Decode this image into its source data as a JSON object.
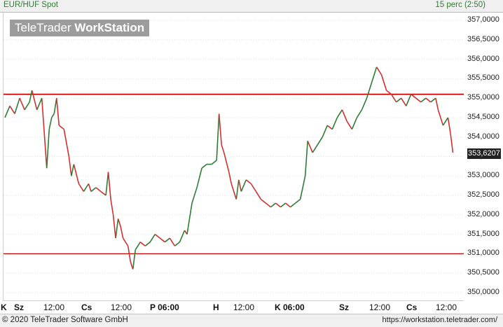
{
  "header": {
    "instrument": "EUR/HUF Spot",
    "interval": "15 perc (2:50)"
  },
  "logo": {
    "brand": "TeleTrader",
    "product": "WorkStation"
  },
  "footer": {
    "copyright": "© 2020 TeleTrader Software GmbH",
    "url": "https://workstation.teletrader.com/"
  },
  "colors": {
    "up": "#2e7d32",
    "down": "#d32f2f",
    "line": "#cc0000",
    "header_text": "#2e7d32"
  },
  "chart_data": {
    "type": "line",
    "ylim": [
      349.8,
      357.2
    ],
    "y_ticks": [
      350.0,
      350.5,
      351.0,
      351.5,
      352.0,
      352.5,
      353.0,
      353.5,
      354.0,
      354.5,
      355.0,
      355.5,
      356.0,
      356.5,
      357.0
    ],
    "y_tick_labels": [
      "350,0000",
      "350,5000",
      "351,0000",
      "351,5000",
      "352,0000",
      "352,5000",
      "353,0000",
      "353,5000",
      "354,0000",
      "354,5000",
      "355,0000",
      "355,5000",
      "356,0000",
      "356,5000",
      "357,0000"
    ],
    "x_ticks": [
      {
        "label": "K",
        "major": true
      },
      {
        "label": "Sz",
        "major": true
      },
      {
        "label": "12:00",
        "major": false
      },
      {
        "label": "Cs",
        "major": true
      },
      {
        "label": "12:00",
        "major": false
      },
      {
        "label": "P 06:00",
        "major": true
      },
      {
        "label": "H",
        "major": true
      },
      {
        "label": "12:00",
        "major": false
      },
      {
        "label": "K 06:00",
        "major": true
      },
      {
        "label": "Sz",
        "major": true
      },
      {
        "label": "12:00",
        "major": false
      },
      {
        "label": "Cs",
        "major": true
      },
      {
        "label": "12:00",
        "major": false
      }
    ],
    "last_price": 353.6207,
    "last_price_label": "353,6207",
    "horizontal_lines": [
      355.1,
      351.0
    ],
    "series": [
      {
        "points": [
          [
            0,
            354.5
          ],
          [
            2,
            354.8
          ],
          [
            4,
            354.6
          ],
          [
            6,
            355.0
          ],
          [
            8,
            354.7
          ],
          [
            10,
            354.9
          ],
          [
            11,
            355.2
          ],
          [
            13,
            354.7
          ],
          [
            15,
            355.0
          ],
          [
            17,
            353.2
          ],
          [
            18,
            354.2
          ],
          [
            19,
            354.5
          ],
          [
            20,
            354.6
          ],
          [
            21,
            355.0
          ],
          [
            22,
            354.3
          ],
          [
            24,
            354.2
          ],
          [
            26,
            353.5
          ],
          [
            27,
            353.0
          ],
          [
            28,
            353.3
          ],
          [
            30,
            352.8
          ],
          [
            32,
            352.6
          ],
          [
            34,
            352.8
          ],
          [
            35,
            352.6
          ],
          [
            37,
            352.7
          ],
          [
            39,
            352.6
          ],
          [
            41,
            352.5
          ],
          [
            42,
            353.1
          ],
          [
            43,
            352.4
          ],
          [
            44,
            352.0
          ],
          [
            45,
            351.4
          ],
          [
            46,
            351.9
          ],
          [
            47,
            351.7
          ],
          [
            48,
            351.4
          ],
          [
            50,
            351.2
          ],
          [
            51,
            350.8
          ],
          [
            52,
            350.6
          ],
          [
            53,
            351.1
          ],
          [
            55,
            351.3
          ],
          [
            57,
            351.2
          ],
          [
            59,
            351.3
          ],
          [
            61,
            351.5
          ],
          [
            63,
            351.4
          ],
          [
            65,
            351.3
          ],
          [
            67,
            351.4
          ],
          [
            69,
            351.2
          ],
          [
            71,
            351.3
          ],
          [
            73,
            351.6
          ],
          [
            74,
            351.5
          ],
          [
            76,
            352.3
          ],
          [
            78,
            352.7
          ],
          [
            80,
            353.2
          ],
          [
            82,
            353.3
          ],
          [
            84,
            353.3
          ],
          [
            86,
            353.4
          ],
          [
            87,
            354.6
          ],
          [
            88,
            353.8
          ],
          [
            89,
            353.6
          ],
          [
            91,
            353.1
          ],
          [
            92,
            352.8
          ],
          [
            94,
            352.4
          ],
          [
            95,
            352.9
          ],
          [
            96,
            352.6
          ],
          [
            98,
            352.9
          ],
          [
            100,
            352.8
          ],
          [
            102,
            352.6
          ],
          [
            104,
            352.4
          ],
          [
            106,
            352.3
          ],
          [
            108,
            352.2
          ],
          [
            110,
            352.3
          ],
          [
            112,
            352.2
          ],
          [
            114,
            352.3
          ],
          [
            116,
            352.2
          ],
          [
            118,
            352.3
          ],
          [
            120,
            352.4
          ],
          [
            122,
            353.0
          ],
          [
            123,
            353.9
          ],
          [
            125,
            353.6
          ],
          [
            127,
            353.8
          ],
          [
            129,
            354.0
          ],
          [
            131,
            354.3
          ],
          [
            133,
            354.2
          ],
          [
            135,
            354.5
          ],
          [
            137,
            354.7
          ],
          [
            139,
            354.4
          ],
          [
            141,
            354.2
          ],
          [
            143,
            354.5
          ],
          [
            145,
            354.7
          ],
          [
            147,
            355.0
          ],
          [
            149,
            355.4
          ],
          [
            151,
            355.8
          ],
          [
            153,
            355.6
          ],
          [
            155,
            355.2
          ],
          [
            157,
            355.1
          ],
          [
            159,
            354.9
          ],
          [
            161,
            355.0
          ],
          [
            163,
            354.8
          ],
          [
            165,
            355.1
          ],
          [
            167,
            355.0
          ],
          [
            169,
            354.9
          ],
          [
            171,
            355.0
          ],
          [
            173,
            354.9
          ],
          [
            175,
            355.0
          ],
          [
            176,
            354.7
          ],
          [
            178,
            354.3
          ],
          [
            180,
            354.5
          ],
          [
            181,
            354.1
          ],
          [
            182,
            353.6
          ]
        ]
      }
    ]
  }
}
